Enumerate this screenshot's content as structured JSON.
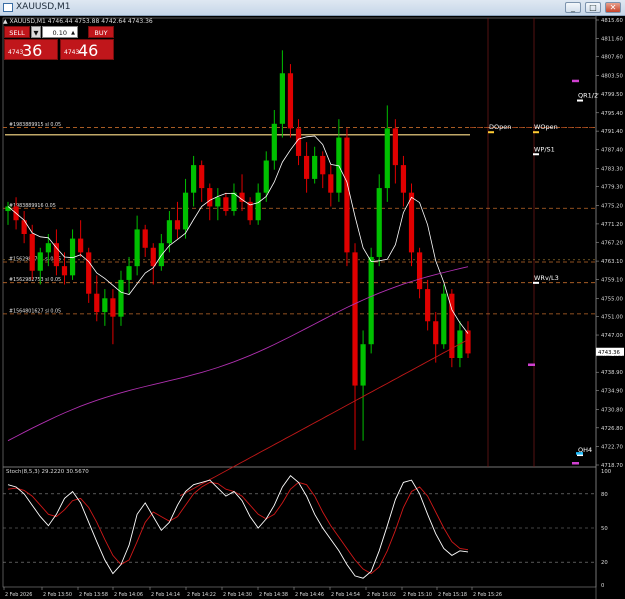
{
  "window": {
    "title": "XAUUSD,M1",
    "buttons": [
      "_",
      "□",
      "✕"
    ]
  },
  "symbol_info": "▲ XAUUSD,M1  4746.44 4753.88 4742.64 4743.36",
  "trade_panel": {
    "sell_label": "SELL",
    "buy_label": "BUY",
    "dropdown_icon": "▼",
    "lot_value": "0.10",
    "lot_arrow": "▲",
    "bid_prefix": "4743",
    "bid_big": "36",
    "ask_prefix": "4743",
    "ask_big": "46"
  },
  "price_axis": {
    "ticks": [
      "4815.60",
      "4811.60",
      "4807.60",
      "4803.50",
      "4799.50",
      "4795.40",
      "4791.40",
      "4787.40",
      "4783.30",
      "4779.30",
      "4775.20",
      "4771.20",
      "4767.20",
      "4763.10",
      "4759.10",
      "4755.00",
      "4751.00",
      "4747.00",
      "4742.90",
      "4738.90",
      "4734.90",
      "4730.80",
      "4726.80",
      "4722.70",
      "4718.70"
    ],
    "current_price": "4743.36"
  },
  "time_axis": {
    "ticks": [
      "2 Feb 2026",
      "2 Feb 13:50",
      "2 Feb 13:58",
      "2 Feb 14:06",
      "2 Feb 14:14",
      "2 Feb 14:22",
      "2 Feb 14:30",
      "2 Feb 14:38",
      "2 Feb 14:46",
      "2 Feb 14:54",
      "2 Feb 15:02",
      "2 Feb 15:10",
      "2 Feb 15:18",
      "2 Feb 15:26"
    ]
  },
  "levels": {
    "left_labels": [
      "#1983889915 sl 0.05",
      "#1983889916 0.05",
      "#1562982761 sl 0.05",
      "#1562982753 sl 0.05",
      "#1564801627 sl 0.05"
    ],
    "right_labels": [
      "DOpen",
      "WOpen",
      "WP/S1",
      "WRv/L3",
      "QR1/2",
      "QH4"
    ]
  },
  "oscillator": {
    "label": "Stoch(8,5,3) 29.2220 30.5670",
    "ticks": [
      "100",
      "80",
      "50",
      "20",
      "0"
    ]
  },
  "colors": {
    "bull": "#00c000",
    "bear": "#e00000",
    "ma_fast": "#ffffff",
    "ma_mid": "#b030b0",
    "ma_slow": "#c01818",
    "level_line": "#ffe08a",
    "dash_level": "#c06a2a"
  },
  "chart_data": {
    "type": "candlestick",
    "ylim": [
      4718.7,
      4815.6
    ],
    "candles": [
      [
        4774,
        4776,
        4771,
        4775
      ],
      [
        4775,
        4777,
        4770,
        4772
      ],
      [
        4772,
        4774,
        4767,
        4769
      ],
      [
        4769,
        4771,
        4759,
        4761
      ],
      [
        4761,
        4766,
        4758,
        4765
      ],
      [
        4765,
        4769,
        4762,
        4767
      ],
      [
        4767,
        4770,
        4760,
        4762
      ],
      [
        4762,
        4765,
        4758,
        4760
      ],
      [
        4760,
        4770,
        4759,
        4768
      ],
      [
        4768,
        4772,
        4764,
        4765
      ],
      [
        4765,
        4766,
        4754,
        4756
      ],
      [
        4756,
        4760,
        4750,
        4752
      ],
      [
        4752,
        4757,
        4749,
        4755
      ],
      [
        4755,
        4757,
        4745,
        4751
      ],
      [
        4751,
        4761,
        4749,
        4759
      ],
      [
        4759,
        4764,
        4756,
        4762
      ],
      [
        4762,
        4773,
        4760,
        4770
      ],
      [
        4770,
        4771,
        4764,
        4766
      ],
      [
        4766,
        4767,
        4758,
        4762
      ],
      [
        4762,
        4769,
        4761,
        4767
      ],
      [
        4767,
        4774,
        4765,
        4772
      ],
      [
        4772,
        4776,
        4768,
        4770
      ],
      [
        4770,
        4781,
        4768,
        4778
      ],
      [
        4778,
        4786,
        4775,
        4784
      ],
      [
        4784,
        4785,
        4776,
        4779
      ],
      [
        4779,
        4780,
        4772,
        4775
      ],
      [
        4775,
        4779,
        4772,
        4777
      ],
      [
        4777,
        4778,
        4773,
        4774
      ],
      [
        4774,
        4780,
        4773,
        4778
      ],
      [
        4778,
        4782,
        4774,
        4776
      ],
      [
        4776,
        4777,
        4771,
        4772
      ],
      [
        4772,
        4780,
        4771,
        4778
      ],
      [
        4778,
        4787,
        4776,
        4785
      ],
      [
        4785,
        4796,
        4783,
        4793
      ],
      [
        4793,
        4809,
        4790,
        4804
      ],
      [
        4804,
        4806,
        4790,
        4792
      ],
      [
        4792,
        4794,
        4784,
        4786
      ],
      [
        4786,
        4789,
        4778,
        4781
      ],
      [
        4781,
        4788,
        4780,
        4786
      ],
      [
        4786,
        4787,
        4779,
        4782
      ],
      [
        4782,
        4784,
        4775,
        4778
      ],
      [
        4778,
        4794,
        4776,
        4790
      ],
      [
        4790,
        4792,
        4762,
        4765
      ],
      [
        4765,
        4767,
        4722,
        4736
      ],
      [
        4736,
        4748,
        4724,
        4745
      ],
      [
        4745,
        4766,
        4743,
        4764
      ],
      [
        4764,
        4782,
        4762,
        4779
      ],
      [
        4779,
        4797,
        4776,
        4792
      ],
      [
        4792,
        4794,
        4780,
        4784
      ],
      [
        4784,
        4786,
        4775,
        4778
      ],
      [
        4778,
        4780,
        4762,
        4765
      ],
      [
        4765,
        4766,
        4755,
        4757
      ],
      [
        4757,
        4759,
        4748,
        4750
      ],
      [
        4750,
        4752,
        4741,
        4745
      ],
      [
        4745,
        4758,
        4744,
        4756
      ],
      [
        4756,
        4757,
        4740,
        4742
      ],
      [
        4742,
        4750,
        4740,
        4748
      ],
      [
        4748,
        4750,
        4742,
        4743
      ]
    ],
    "oscillator_main": [
      88,
      86,
      80,
      70,
      60,
      52,
      62,
      76,
      82,
      72,
      55,
      38,
      22,
      10,
      18,
      35,
      62,
      72,
      60,
      48,
      55,
      70,
      82,
      88,
      90,
      92,
      85,
      78,
      82,
      74,
      60,
      50,
      58,
      70,
      86,
      96,
      90,
      78,
      62,
      50,
      40,
      30,
      18,
      8,
      6,
      12,
      30,
      52,
      75,
      90,
      92,
      80,
      62,
      45,
      32,
      26,
      30,
      29
    ],
    "oscillator_signal": [
      84,
      85,
      83,
      78,
      70,
      62,
      60,
      66,
      74,
      76,
      68,
      55,
      40,
      26,
      18,
      22,
      38,
      55,
      64,
      60,
      56,
      60,
      70,
      80,
      86,
      90,
      89,
      84,
      82,
      78,
      70,
      62,
      58,
      62,
      72,
      84,
      90,
      88,
      78,
      64,
      52,
      42,
      32,
      22,
      14,
      10,
      16,
      30,
      48,
      68,
      82,
      86,
      78,
      64,
      50,
      38,
      32,
      31
    ]
  }
}
